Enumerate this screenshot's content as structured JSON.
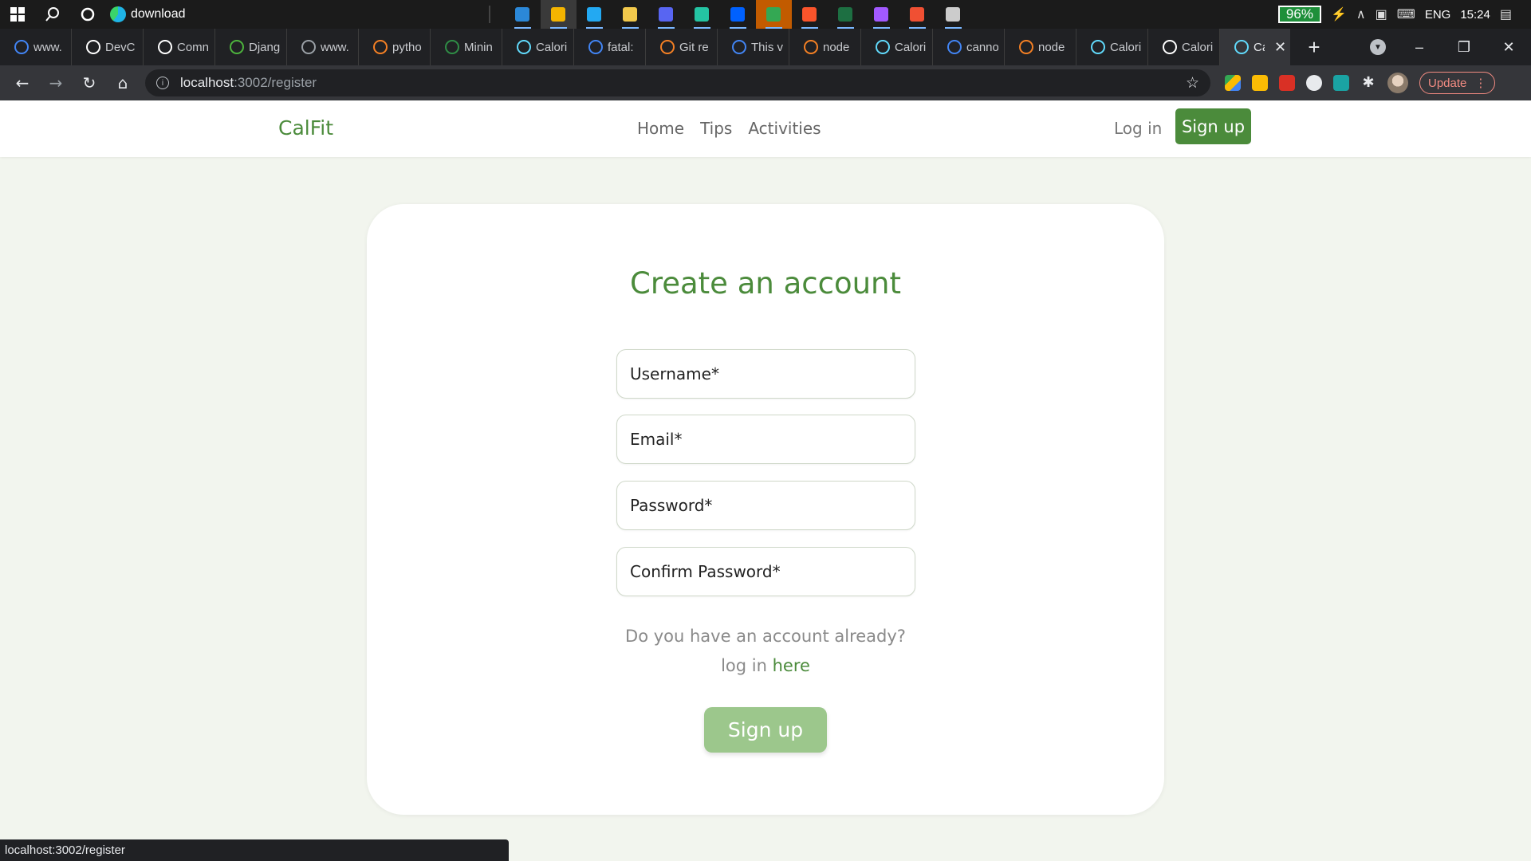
{
  "taskbar": {
    "active_app_title": "download",
    "apps": [
      {
        "icon": "mail-icon",
        "color": "#2b88d8"
      },
      {
        "icon": "chrome-icon",
        "color": "#f4b400"
      },
      {
        "icon": "vscode-icon",
        "color": "#23a9f2"
      },
      {
        "icon": "file-explorer-icon",
        "color": "#f2c94c"
      },
      {
        "icon": "discord-icon",
        "color": "#5865f2"
      },
      {
        "icon": "gitkraken-icon",
        "color": "#24c4a3"
      },
      {
        "icon": "dropbox-icon",
        "color": "#0061ff"
      },
      {
        "icon": "drive-icon",
        "color": "#34a853"
      },
      {
        "icon": "brave-icon",
        "color": "#fb542b"
      },
      {
        "icon": "excel-icon",
        "color": "#1d6f42"
      },
      {
        "icon": "figma-icon",
        "color": "#a259ff"
      },
      {
        "icon": "git-icon",
        "color": "#f05033"
      },
      {
        "icon": "terminal-icon",
        "color": "#cccccc"
      }
    ],
    "battery": "96%",
    "language": "ENG",
    "time": "15:24"
  },
  "tabs": [
    {
      "label": "www.",
      "icon": "google-icon",
      "color": "#4285f4"
    },
    {
      "label": "DevC",
      "icon": "github-icon",
      "color": "#ffffff"
    },
    {
      "label": "Comn",
      "icon": "github-icon",
      "color": "#ffffff"
    },
    {
      "label": "Djang",
      "icon": "mongodb-icon",
      "color": "#4db33d"
    },
    {
      "label": "www.",
      "icon": "globe-icon",
      "color": "#9aa0a6"
    },
    {
      "label": "pytho",
      "icon": "stackoverflow-icon",
      "color": "#f48024"
    },
    {
      "label": "Minin",
      "icon": "geeksforgeeks-icon",
      "color": "#2f8d46"
    },
    {
      "label": "Calori",
      "icon": "react-icon",
      "color": "#61dafb"
    },
    {
      "label": "fatal:",
      "icon": "google-icon",
      "color": "#4285f4"
    },
    {
      "label": "Git re",
      "icon": "stackoverflow-icon",
      "color": "#f48024"
    },
    {
      "label": "This v",
      "icon": "google-icon",
      "color": "#4285f4"
    },
    {
      "label": "node",
      "icon": "stackoverflow-icon",
      "color": "#f48024"
    },
    {
      "label": "Calori",
      "icon": "react-icon",
      "color": "#61dafb"
    },
    {
      "label": "canno",
      "icon": "google-icon",
      "color": "#4285f4"
    },
    {
      "label": "node",
      "icon": "stackoverflow-icon",
      "color": "#f48024"
    },
    {
      "label": "Calori",
      "icon": "react-icon",
      "color": "#61dafb"
    },
    {
      "label": "Calori",
      "icon": "github-icon",
      "color": "#ffffff"
    },
    {
      "label": "Ca",
      "icon": "react-icon",
      "color": "#61dafb",
      "active": true
    }
  ],
  "toolbar": {
    "url_host": "localhost",
    "url_path": ":3002/register",
    "update_label": "Update"
  },
  "site": {
    "brand": "CalFit",
    "nav": [
      "Home",
      "Tips",
      "Activities"
    ],
    "login_label": "Log in",
    "signup_label": "Sign up"
  },
  "form": {
    "title": "Create an account",
    "fields": [
      "Username*",
      "Email*",
      "Password*",
      "Confirm Password*"
    ],
    "hint_line1": "Do you have an account already?",
    "hint_line2_prefix": "log in",
    "hint_link": "here",
    "submit_label": "Sign up"
  },
  "status_bubble": "localhost:3002/register",
  "colors": {
    "brand_green": "#4b8b3b",
    "button_light_green": "#9cc78c",
    "page_bg": "#f2f5ee"
  }
}
